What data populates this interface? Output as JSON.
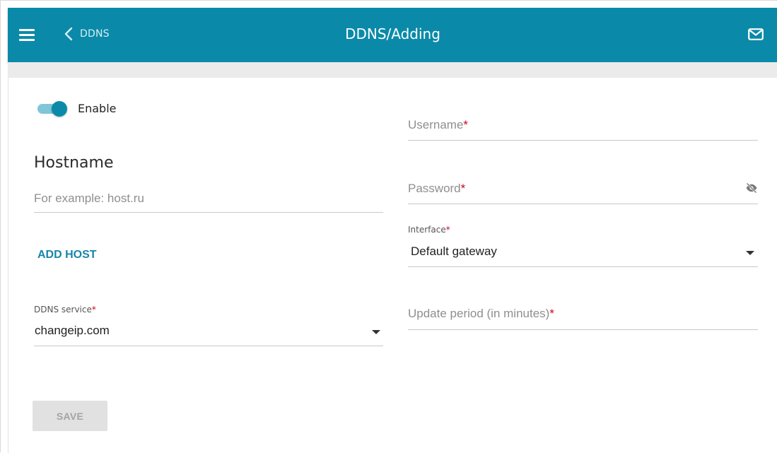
{
  "header": {
    "title": "DDNS/Adding",
    "back_label": "DDNS",
    "color": "#0a8aa8"
  },
  "icons": {
    "menu": "menu-icon",
    "back": "chevron-left-icon",
    "mail": "mail-icon",
    "password_visibility": "eye-off-icon",
    "dropdown": "caret-down-icon"
  },
  "form": {
    "enable_label": "Enable",
    "enable_on": true,
    "hostname_section": "Hostname",
    "hostname_placeholder": "For example: host.ru",
    "add_host_label": "ADD HOST",
    "ddns_service_label": "DDNS service",
    "ddns_service_value": "changeip.com",
    "username_placeholder": "Username",
    "password_placeholder": "Password",
    "interface_label": "Interface",
    "interface_value": "Default gateway",
    "update_period_placeholder": "Update period (in minutes)",
    "required_mark": "*",
    "save_label": "SAVE"
  },
  "colors": {
    "accent": "#0a8aa8",
    "link": "#1686a8",
    "required": "#d0021b",
    "disabled_button": "#e1e1e1"
  }
}
